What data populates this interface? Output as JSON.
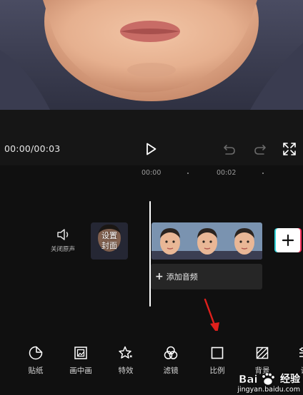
{
  "player": {
    "time_readout": "00:00/00:03",
    "play_icon": "play-icon",
    "undo_icon": "undo-icon",
    "redo_icon": "redo-icon",
    "fullscreen_icon": "fullscreen-icon"
  },
  "timeline": {
    "ruler": [
      "00:00",
      "00:02"
    ],
    "mute_label": "关闭原声",
    "cover_label_line1": "设置",
    "cover_label_line2": "封面",
    "add_audio_label": "添加音频",
    "add_clip_icon": "plus-icon"
  },
  "toolbar": {
    "items": [
      {
        "label": "贴纸",
        "icon": "sticker-icon"
      },
      {
        "label": "画中画",
        "icon": "picture-in-picture-icon"
      },
      {
        "label": "特效",
        "icon": "effects-star-icon"
      },
      {
        "label": "滤镜",
        "icon": "filter-icon"
      },
      {
        "label": "比例",
        "icon": "ratio-icon"
      },
      {
        "label": "背景",
        "icon": "background-icon"
      },
      {
        "label": "调",
        "icon": "adjust-icon"
      }
    ]
  },
  "watermark": {
    "brand": "Bai",
    "name_cn": "经验",
    "url": "jingyan.baidu.com"
  },
  "colors": {
    "background": "#101010",
    "player_bar": "#161616",
    "annotation_arrow": "#e0201c",
    "add_clip_cyan": "#2fd1d6",
    "add_clip_pink": "#ff2f5b"
  }
}
